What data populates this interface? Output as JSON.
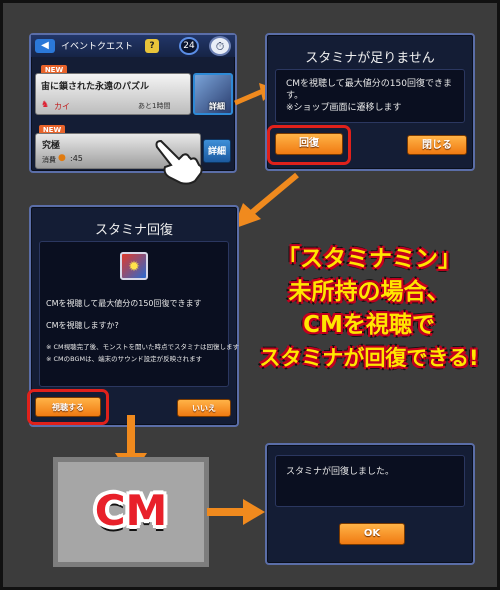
{
  "screen1": {
    "header_title": "イベントクエスト",
    "level": "24",
    "quest1": {
      "badge": "NEW",
      "name": "宙に鎖された永遠のパズル",
      "boss": "カイ",
      "time_left": "あと1時間",
      "detail": "詳細"
    },
    "quest2": {
      "badge": "NEW",
      "name": "究極",
      "stamina_label": "消費",
      "stamina_value": ":45",
      "detail": "詳細"
    }
  },
  "dialog_stamina_short": {
    "title": "スタミナが足りません",
    "body": "CMを視聴して最大値分の150回復できます。",
    "note": "※ショップ画面に遷移します",
    "recover_button": "回復",
    "close_button": "閉じる"
  },
  "dialog_recover": {
    "title": "スタミナ回復",
    "line1": "CMを視聴して最大値分の150回復できます",
    "line2": "CMを視聴しますか?",
    "note1": "※ CM視聴完了後、モンストを開いた時点でスタミナは回復します",
    "note2": "※ CMのBGMは、端末のサウンド設定が反映されます",
    "watch_button": "視聴する",
    "no_button": "いいえ"
  },
  "caption": {
    "line1": "「スタミナミン」",
    "line2": "未所持の場合、",
    "line3": "CMを視聴で",
    "line4": "スタミナが回復できる!"
  },
  "cm_label": "CM",
  "dialog_done": {
    "message": "スタミナが回復しました。",
    "ok_button": "OK"
  },
  "colors": {
    "arrow": "#f08a1e",
    "highlight": "#e0211b",
    "caption_fill": "#ffe600"
  }
}
